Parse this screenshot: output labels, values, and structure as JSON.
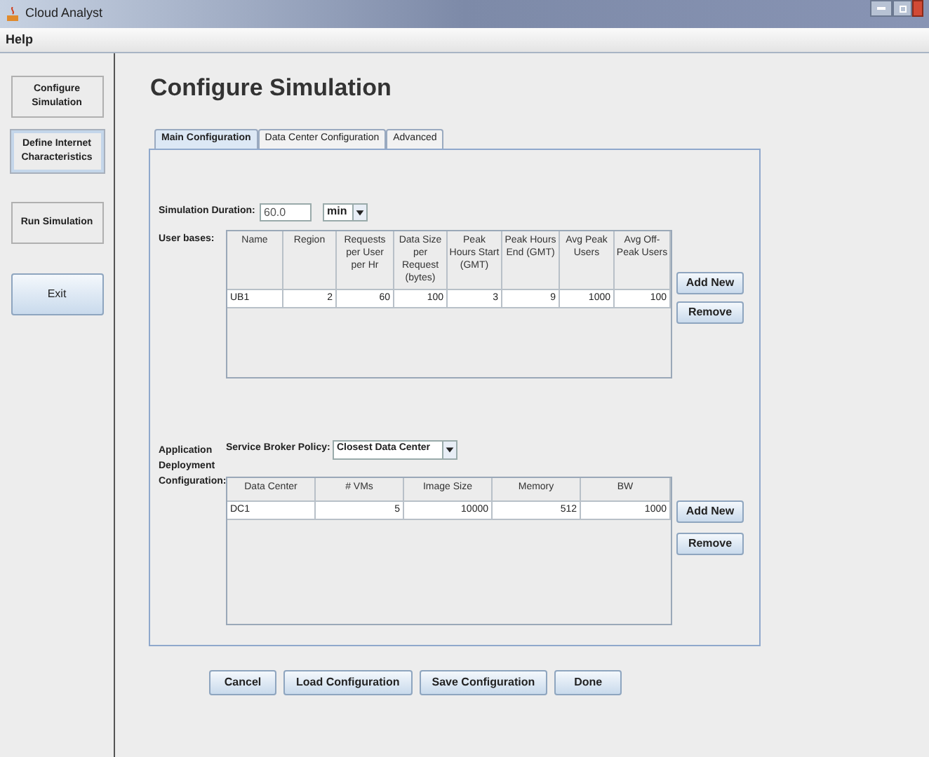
{
  "window": {
    "title": "Cloud Analyst"
  },
  "menu": [
    "Help"
  ],
  "sidebar": {
    "items": [
      {
        "label": "Configure Simulation",
        "kind": "nav"
      },
      {
        "label": "Define Internet Characteristics",
        "kind": "focused"
      },
      {
        "label": "Run Simulation",
        "kind": "nav"
      },
      {
        "label": "Exit",
        "kind": "action"
      }
    ]
  },
  "page_title": "Configure Simulation",
  "tabs": [
    {
      "label": "Main Configuration",
      "selected": true
    },
    {
      "label": "Data Center Configuration",
      "selected": false
    },
    {
      "label": "Advanced",
      "selected": false
    }
  ],
  "duration": {
    "label": "Simulation Duration:",
    "value": "60.0",
    "unit": "min"
  },
  "user_bases": {
    "label": "User bases:",
    "columns": [
      "Name",
      "Region",
      "Requests per User per Hr",
      "Data Size per Request (bytes)",
      "Peak Hours Start (GMT)",
      "Peak Hours End (GMT)",
      "Avg Peak Users",
      "Avg Off-Peak Users"
    ],
    "rows": [
      [
        "UB1",
        "2",
        "60",
        "100",
        "3",
        "9",
        "1000",
        "100"
      ]
    ],
    "buttons": [
      "Add New",
      "Remove"
    ]
  },
  "deployment": {
    "label": "Application Deployment Configuration:",
    "policy_label": "Service Broker Policy:",
    "policy_value": "Closest Data Center",
    "columns": [
      "Data Center",
      "# VMs",
      "Image Size",
      "Memory",
      "BW"
    ],
    "rows": [
      [
        "DC1",
        "5",
        "10000",
        "512",
        "1000"
      ]
    ],
    "buttons": [
      "Add New",
      "Remove"
    ]
  },
  "footer_buttons": [
    "Cancel",
    "Load Configuration",
    "Save Configuration",
    "Done"
  ]
}
